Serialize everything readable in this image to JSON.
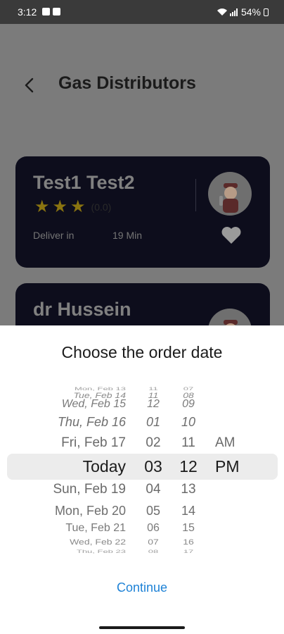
{
  "status_bar": {
    "time": "3:12",
    "battery": "54%"
  },
  "header": {
    "title": "Gas Distributors"
  },
  "cards": [
    {
      "name": "Test1 Test2",
      "rating_text": "(0.0)",
      "deliver_label": "Deliver in",
      "deliver_time": "19 Min"
    },
    {
      "name": "dr Hussein"
    }
  ],
  "sheet": {
    "title": "Choose the order date",
    "continue_label": "Continue",
    "picker_rows": [
      {
        "date": "Mon, Feb 13",
        "hour": "11",
        "minute": "07",
        "ampm": ""
      },
      {
        "date": "Tue, Feb 14",
        "hour": "11",
        "minute": "08",
        "ampm": ""
      },
      {
        "date": "Wed, Feb 15",
        "hour": "12",
        "minute": "09",
        "ampm": ""
      },
      {
        "date": "Thu, Feb 16",
        "hour": "01",
        "minute": "10",
        "ampm": ""
      },
      {
        "date": "Fri, Feb 17",
        "hour": "02",
        "minute": "11",
        "ampm": "AM"
      },
      {
        "date": "Today",
        "hour": "03",
        "minute": "12",
        "ampm": "PM"
      },
      {
        "date": "Sun, Feb 19",
        "hour": "04",
        "minute": "13",
        "ampm": ""
      },
      {
        "date": "Mon, Feb 20",
        "hour": "05",
        "minute": "14",
        "ampm": ""
      },
      {
        "date": "Tue, Feb 21",
        "hour": "06",
        "minute": "15",
        "ampm": ""
      },
      {
        "date": "Wed, Feb 22",
        "hour": "07",
        "minute": "16",
        "ampm": ""
      },
      {
        "date": "Thu, Feb 23",
        "hour": "08",
        "minute": "17",
        "ampm": ""
      }
    ]
  }
}
